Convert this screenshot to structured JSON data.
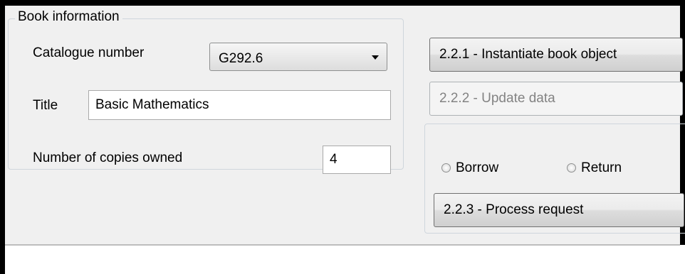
{
  "book_info": {
    "group_title": "Book information",
    "catalogue_label": "Catalogue number",
    "catalogue_value": "G292.6",
    "title_label": "Title",
    "title_value": "Basic Mathematics",
    "copies_label": "Number of copies owned",
    "copies_value": "4"
  },
  "actions": {
    "instantiate_label": "2.2.1 - Instantiate book object",
    "update_label": "2.2.2 - Update data",
    "borrow_label": "Borrow",
    "return_label": "Return",
    "process_label": "2.2.3 - Process request"
  }
}
